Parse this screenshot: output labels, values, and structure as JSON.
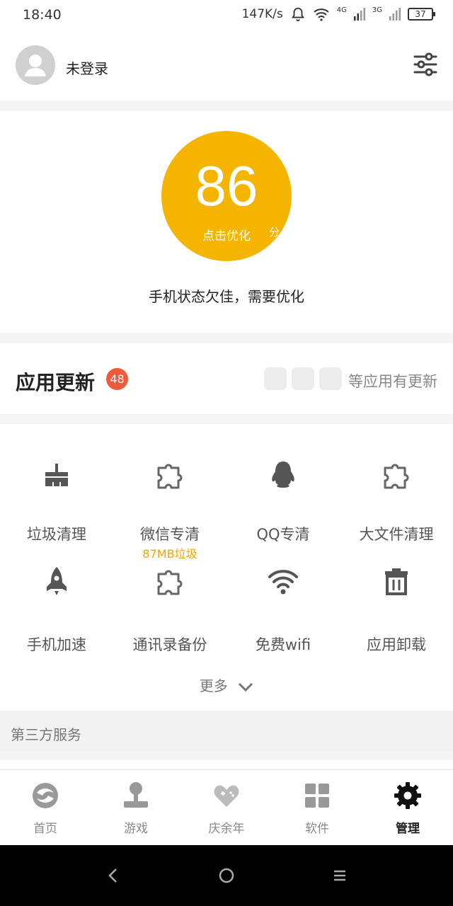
{
  "status_bar": {
    "time": "18:40",
    "net_speed": "147K/s",
    "signal1": "4G",
    "signal2": "3G",
    "battery": "37"
  },
  "header": {
    "login_text": "未登录",
    "avatar_icon": "user-avatar-icon",
    "settings_icon": "sliders-icon"
  },
  "score": {
    "value": "86",
    "unit": "分",
    "action": "点击优化",
    "status": "手机状态欠佳，需要优化",
    "color": "#f4b400"
  },
  "updates": {
    "title": "应用更新",
    "badge": "48",
    "suffix": "等应用有更新",
    "badge_color": "#f05a3c"
  },
  "tools": [
    {
      "label": "垃圾清理",
      "icon": "broom-icon",
      "sub": ""
    },
    {
      "label": "微信专清",
      "icon": "puzzle-icon",
      "sub": "87MB垃圾"
    },
    {
      "label": "QQ专清",
      "icon": "penguin-icon",
      "sub": ""
    },
    {
      "label": "大文件清理",
      "icon": "puzzle-icon",
      "sub": ""
    },
    {
      "label": "手机加速",
      "icon": "rocket-icon",
      "sub": ""
    },
    {
      "label": "通讯录备份",
      "icon": "puzzle-icon",
      "sub": ""
    },
    {
      "label": "免费wifi",
      "icon": "wifi-icon",
      "sub": ""
    },
    {
      "label": "应用卸载",
      "icon": "trash-icon",
      "sub": ""
    }
  ],
  "more_label": "更多",
  "third_party_title": "第三方服务",
  "tabs": [
    {
      "label": "首页",
      "icon": "home-swirl-icon",
      "active": false
    },
    {
      "label": "游戏",
      "icon": "joystick-icon",
      "active": false
    },
    {
      "label": "庆余年",
      "icon": "heart-gamepad-icon",
      "active": false
    },
    {
      "label": "软件",
      "icon": "grid-apps-icon",
      "active": false
    },
    {
      "label": "管理",
      "icon": "gear-icon",
      "active": true
    }
  ]
}
